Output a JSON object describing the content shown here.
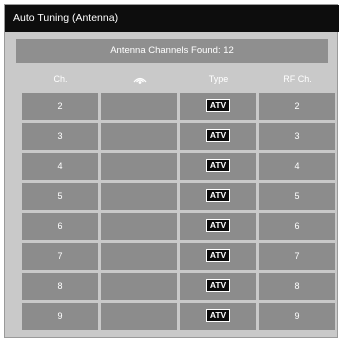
{
  "window": {
    "title": "Auto Tuning (Antenna)"
  },
  "status": {
    "found_text": "Antenna Channels Found: 12"
  },
  "table": {
    "headers": {
      "ch": "Ch.",
      "icon": "antenna-signal-icon",
      "type": "Type",
      "rf": "RF Ch."
    },
    "rows": [
      {
        "ch": "2",
        "name": "",
        "type": "ATV",
        "rf": "2"
      },
      {
        "ch": "3",
        "name": "",
        "type": "ATV",
        "rf": "3"
      },
      {
        "ch": "4",
        "name": "",
        "type": "ATV",
        "rf": "4"
      },
      {
        "ch": "5",
        "name": "",
        "type": "ATV",
        "rf": "5"
      },
      {
        "ch": "6",
        "name": "",
        "type": "ATV",
        "rf": "6"
      },
      {
        "ch": "7",
        "name": "",
        "type": "ATV",
        "rf": "7"
      },
      {
        "ch": "8",
        "name": "",
        "type": "ATV",
        "rf": "8"
      },
      {
        "ch": "9",
        "name": "",
        "type": "ATV",
        "rf": "9"
      }
    ]
  },
  "colors": {
    "title_bar": "#0d0d0d",
    "panel": "#c9c9c9",
    "cell": "#8c8c8c",
    "badge": "#0a0a0a"
  }
}
